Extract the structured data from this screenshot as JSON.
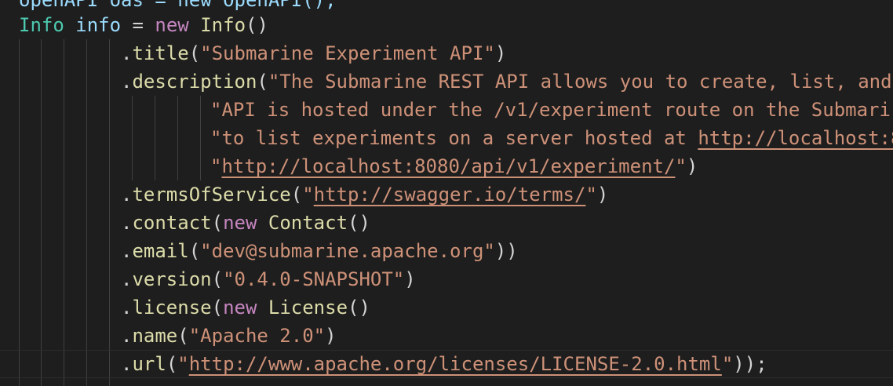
{
  "editor": {
    "lines": [
      {
        "indent": 0,
        "tokens": [
          {
            "t": "openAPI oas = new OpenAPI();",
            "c": "var"
          }
        ]
      },
      {
        "indent": 0,
        "tokens": [
          {
            "t": "Info",
            "c": "type"
          },
          {
            "t": " ",
            "c": "op"
          },
          {
            "t": "info",
            "c": "var"
          },
          {
            "t": " = ",
            "c": "op"
          },
          {
            "t": "new",
            "c": "kw"
          },
          {
            "t": " ",
            "c": "op"
          },
          {
            "t": "Info",
            "c": "cls"
          },
          {
            "t": "()",
            "c": "op"
          }
        ]
      },
      {
        "indent": 0,
        "tokens": [
          {
            "t": ".",
            "c": "op"
          },
          {
            "t": "title",
            "c": "fn"
          },
          {
            "t": "(",
            "c": "op"
          },
          {
            "t": "\"Submarine Experiment API\"",
            "c": "str"
          },
          {
            "t": ")",
            "c": "op"
          }
        ]
      },
      {
        "indent": 0,
        "tokens": [
          {
            "t": ".",
            "c": "op"
          },
          {
            "t": "description",
            "c": "fn"
          },
          {
            "t": "(",
            "c": "op"
          },
          {
            "t": "\"The Submarine REST API allows you to create, list, and",
            "c": "str"
          }
        ]
      },
      {
        "indent": 0,
        "tokens": [
          {
            "t": "\"API is hosted under the /v1/experiment route on the Submari",
            "c": "str"
          }
        ]
      },
      {
        "indent": 0,
        "tokens": [
          {
            "t": "\"to list experiments on a server hosted at ",
            "c": "str"
          },
          {
            "t": "http://localhost:8",
            "c": "url"
          }
        ]
      },
      {
        "indent": 0,
        "tokens": [
          {
            "t": "\"",
            "c": "str"
          },
          {
            "t": "http://localhost:8080/api/v1/experiment/",
            "c": "url"
          },
          {
            "t": "\"",
            "c": "str"
          },
          {
            "t": ")",
            "c": "op"
          }
        ]
      },
      {
        "indent": 0,
        "tokens": [
          {
            "t": ".",
            "c": "op"
          },
          {
            "t": "termsOfService",
            "c": "fn"
          },
          {
            "t": "(",
            "c": "op"
          },
          {
            "t": "\"",
            "c": "str"
          },
          {
            "t": "http://swagger.io/terms/",
            "c": "url"
          },
          {
            "t": "\"",
            "c": "str"
          },
          {
            "t": ")",
            "c": "op"
          }
        ]
      },
      {
        "indent": 0,
        "tokens": [
          {
            "t": ".",
            "c": "op"
          },
          {
            "t": "contact",
            "c": "fn"
          },
          {
            "t": "(",
            "c": "op"
          },
          {
            "t": "new",
            "c": "kw"
          },
          {
            "t": " ",
            "c": "op"
          },
          {
            "t": "Contact",
            "c": "cls"
          },
          {
            "t": "()",
            "c": "op"
          }
        ]
      },
      {
        "indent": 0,
        "tokens": [
          {
            "t": ".",
            "c": "op"
          },
          {
            "t": "email",
            "c": "fn"
          },
          {
            "t": "(",
            "c": "op"
          },
          {
            "t": "\"dev@submarine.apache.org\"",
            "c": "str"
          },
          {
            "t": "))",
            "c": "op"
          }
        ]
      },
      {
        "indent": 0,
        "tokens": [
          {
            "t": ".",
            "c": "op"
          },
          {
            "t": "version",
            "c": "fn"
          },
          {
            "t": "(",
            "c": "op"
          },
          {
            "t": "\"0.4.0-SNAPSHOT\"",
            "c": "str"
          },
          {
            "t": ")",
            "c": "op"
          }
        ]
      },
      {
        "indent": 0,
        "tokens": [
          {
            "t": ".",
            "c": "op"
          },
          {
            "t": "license",
            "c": "fn"
          },
          {
            "t": "(",
            "c": "op"
          },
          {
            "t": "new",
            "c": "kw"
          },
          {
            "t": " ",
            "c": "op"
          },
          {
            "t": "License",
            "c": "cls"
          },
          {
            "t": "()",
            "c": "op"
          }
        ]
      },
      {
        "indent": 0,
        "tokens": [
          {
            "t": ".",
            "c": "op"
          },
          {
            "t": "name",
            "c": "fn"
          },
          {
            "t": "(",
            "c": "op"
          },
          {
            "t": "\"Apache 2.0\"",
            "c": "str"
          },
          {
            "t": ")",
            "c": "op"
          }
        ]
      },
      {
        "indent": 0,
        "tokens": [
          {
            "t": ".",
            "c": "op"
          },
          {
            "t": "url",
            "c": "fn"
          },
          {
            "t": "(",
            "c": "op"
          },
          {
            "t": "\"",
            "c": "str"
          },
          {
            "t": "http://www.apache.org/licenses/LICENSE-2.0.html",
            "c": "url"
          },
          {
            "t": "\"",
            "c": "str"
          },
          {
            "t": "));",
            "c": "op"
          }
        ]
      }
    ]
  },
  "colors": {
    "background": "#1e1e1e",
    "type": "#4ec9b0",
    "variable": "#9cdcfe",
    "keyword": "#c586c0",
    "function": "#dcdcaa",
    "string": "#ce9178",
    "punctuation": "#d4d4d4",
    "indent_guide": "#404040"
  }
}
